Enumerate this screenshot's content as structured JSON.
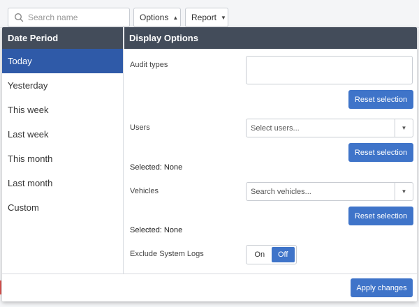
{
  "toolbar": {
    "search_placeholder": "Search name",
    "options_label": "Options",
    "report_label": "Report"
  },
  "date_period": {
    "header": "Date Period",
    "items": [
      {
        "label": "Today",
        "active": true
      },
      {
        "label": "Yesterday",
        "active": false
      },
      {
        "label": "This week",
        "active": false
      },
      {
        "label": "Last week",
        "active": false
      },
      {
        "label": "This month",
        "active": false
      },
      {
        "label": "Last month",
        "active": false
      },
      {
        "label": "Custom",
        "active": false
      }
    ]
  },
  "display_options": {
    "header": "Display Options",
    "audit_types": {
      "label": "Audit types",
      "reset_label": "Reset selection"
    },
    "users": {
      "label": "Users",
      "placeholder": "Select users...",
      "reset_label": "Reset selection",
      "selected_text": "Selected: None"
    },
    "vehicles": {
      "label": "Vehicles",
      "placeholder": "Search vehicles...",
      "reset_label": "Reset selection",
      "selected_text": "Selected: None"
    },
    "exclude_system_logs": {
      "label": "Exclude System Logs",
      "on_label": "On",
      "off_label": "Off",
      "value": "Off"
    }
  },
  "footer": {
    "apply_label": "Apply changes"
  },
  "colors": {
    "accent": "#3f74c9",
    "header_bg": "#434c5a",
    "active_item": "#2f5aa8"
  }
}
